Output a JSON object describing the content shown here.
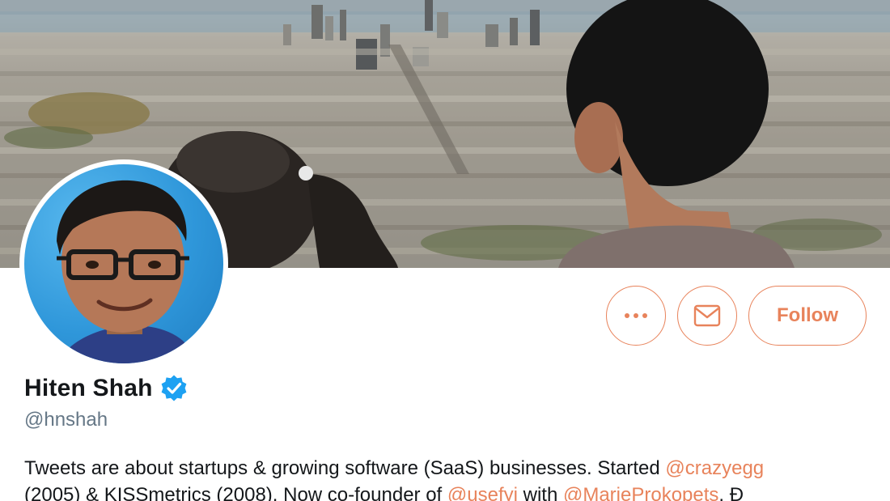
{
  "profile": {
    "name": "Hiten Shah",
    "handle": "@hnshah",
    "verified": true
  },
  "actions": {
    "more_icon": "more-dots-icon",
    "message_icon": "envelope-icon",
    "follow_label": "Follow"
  },
  "bio": {
    "line1_text": "Tweets are about startups & growing software (SaaS) businesses. Started ",
    "line1_mention": "@crazyegg",
    "line2_text_a": "(2005) & KISSmetrics (2008). Now co-founder of ",
    "line2_mention_a": "@usefyi",
    "line2_text_b": " with ",
    "line2_mention_b": "@MarieProkopets",
    "line2_text_c": ". Ð"
  },
  "colors": {
    "accent": "#e8835b",
    "text": "#14171a",
    "secondary_text": "#657786",
    "verified_badge": "#1da1f2"
  }
}
